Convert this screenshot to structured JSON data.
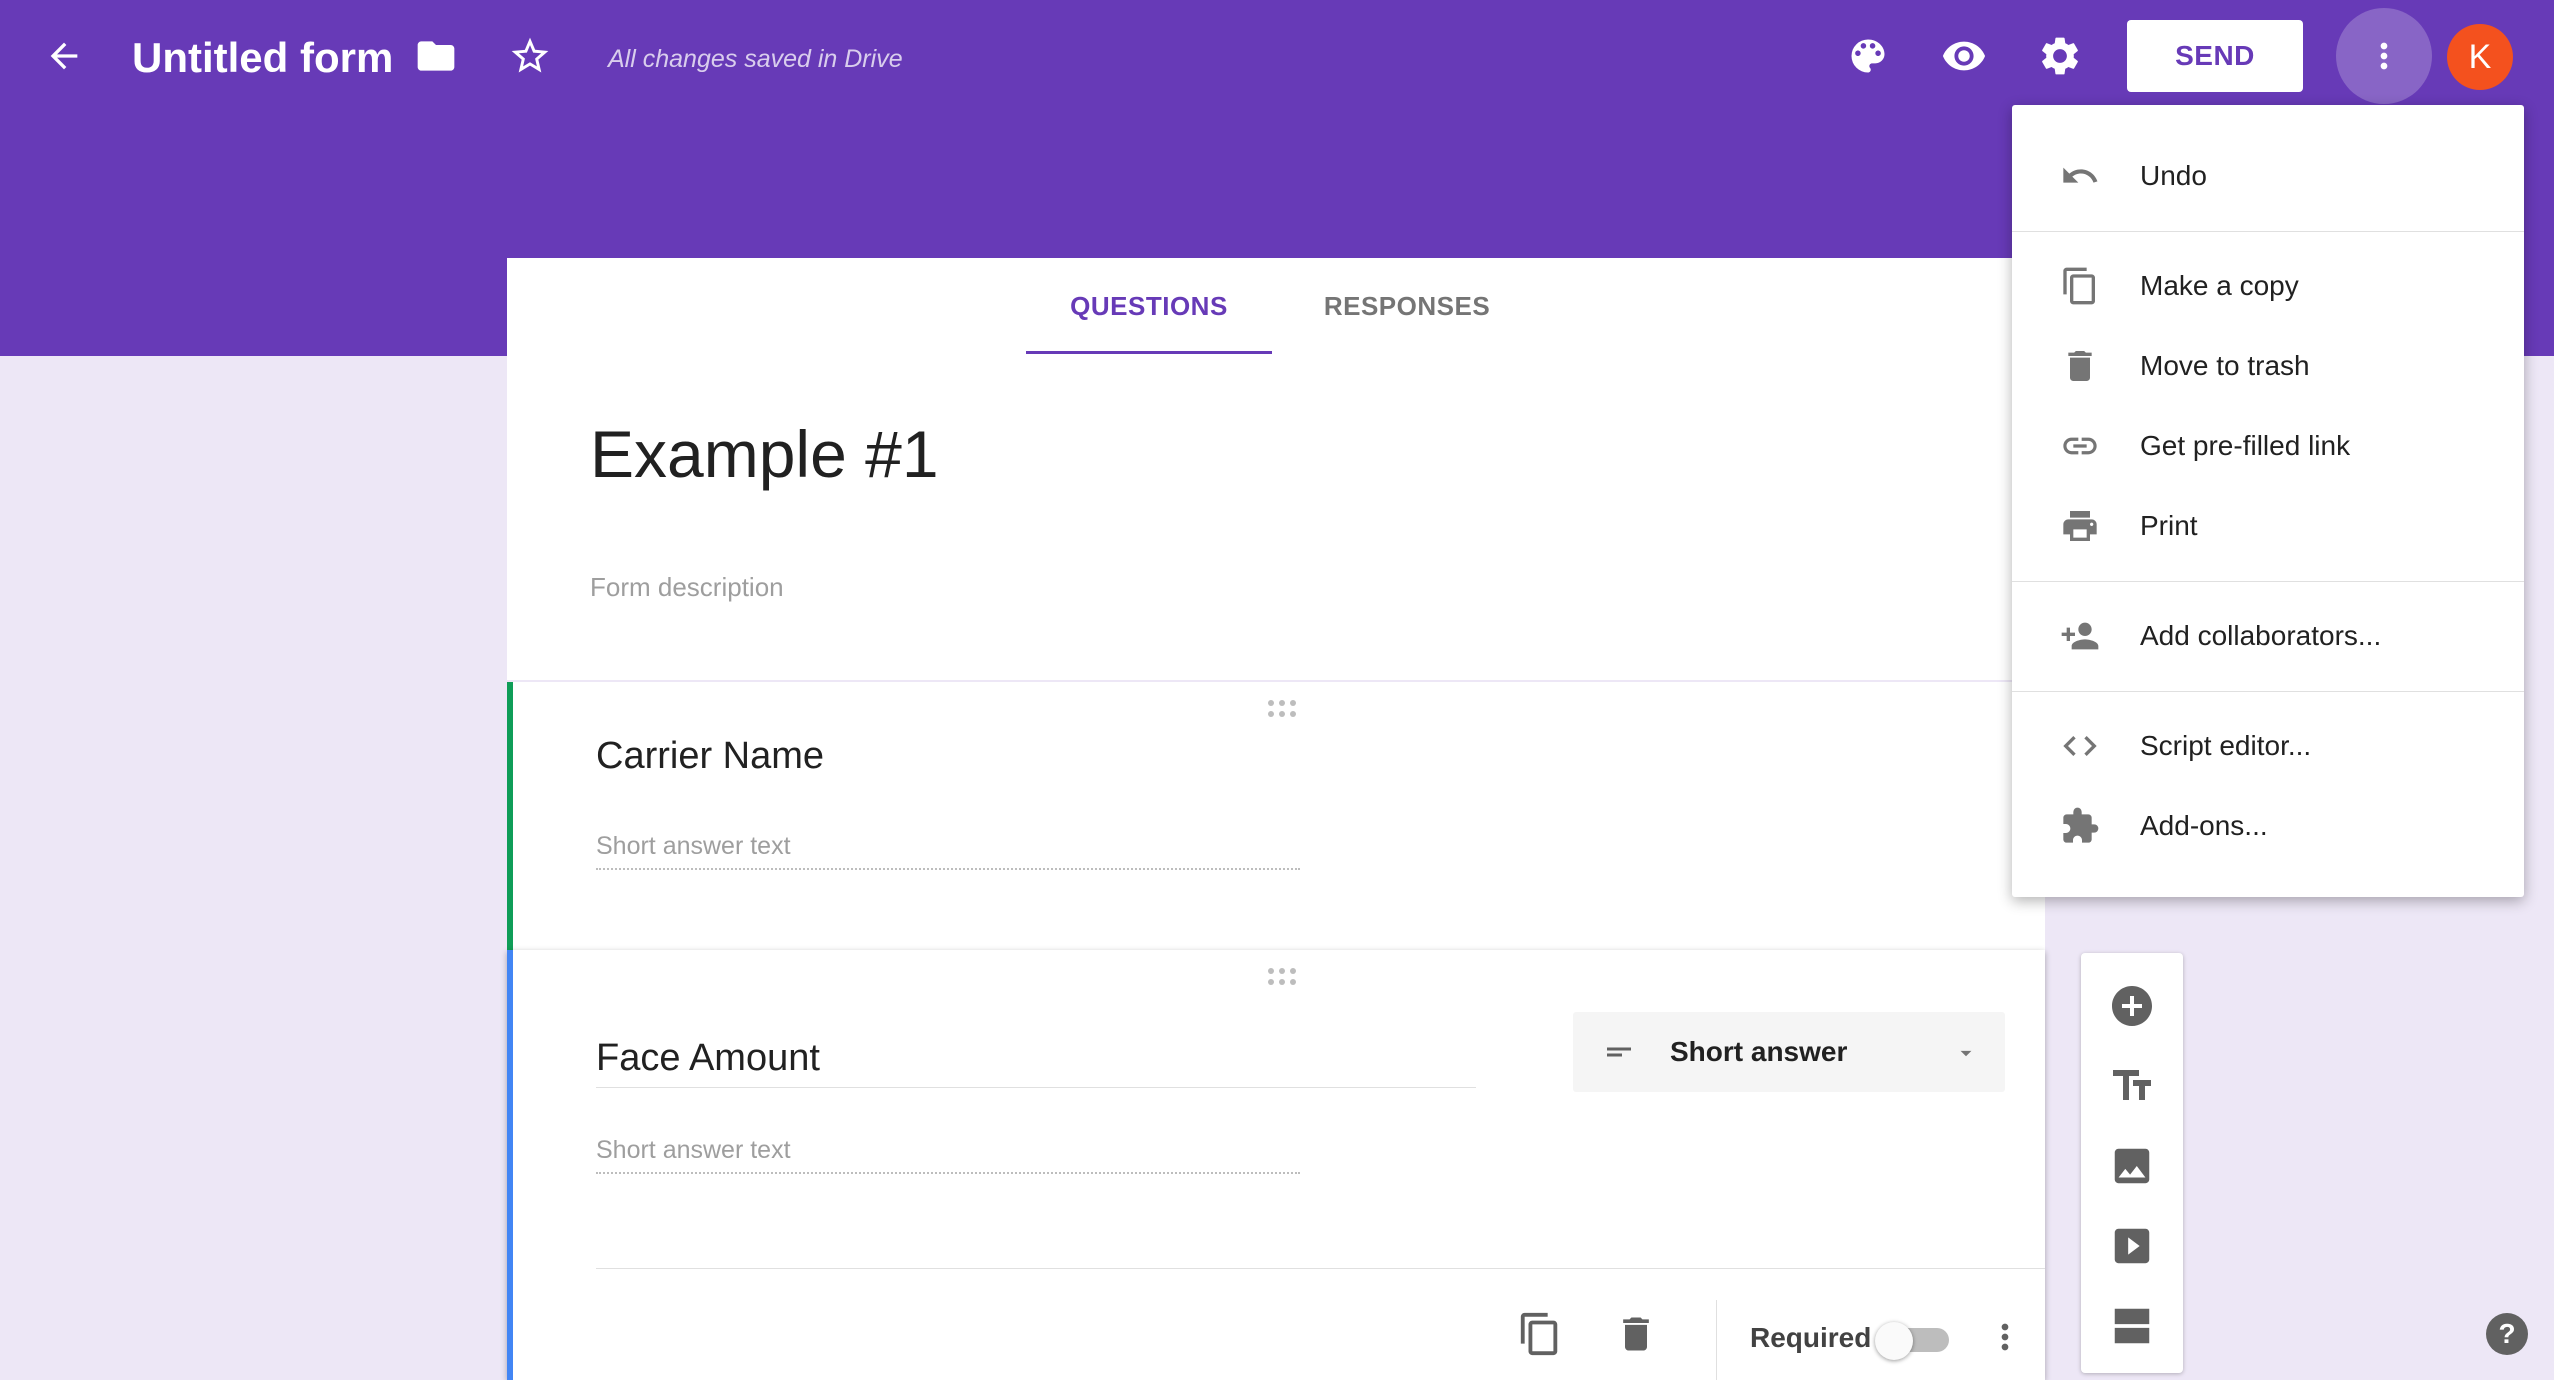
{
  "colors": {
    "accent": "#673ab7",
    "background": "#ede7f6",
    "avatar": "#f4511e",
    "card_green": "#0f9d58",
    "card_blue": "#4285f4"
  },
  "header": {
    "title": "Untitled form",
    "saved_status": "All changes saved in Drive",
    "send_label": "SEND",
    "avatar_initial": "K",
    "icons": [
      "back-arrow-icon",
      "folder-icon",
      "star-icon",
      "palette-icon",
      "eye-icon",
      "gear-icon",
      "more-vert-icon"
    ]
  },
  "tabs": [
    {
      "label": "QUESTIONS",
      "active": true
    },
    {
      "label": "RESPONSES",
      "active": false
    }
  ],
  "form": {
    "title": "Example #1",
    "description_placeholder": "Form description"
  },
  "questions": [
    {
      "title": "Carrier Name",
      "answer_placeholder": "Short answer text"
    },
    {
      "title": "Face Amount",
      "answer_placeholder": "Short answer text",
      "type": "Short answer",
      "required_label": "Required",
      "required": false
    }
  ],
  "menu": {
    "items": [
      {
        "label": "Undo",
        "icon": "undo-icon"
      },
      {
        "label": "Make a copy",
        "icon": "copy-icon"
      },
      {
        "label": "Move to trash",
        "icon": "trash-icon"
      },
      {
        "label": "Get pre-filled link",
        "icon": "link-icon"
      },
      {
        "label": "Print",
        "icon": "print-icon"
      },
      {
        "label": "Add collaborators...",
        "icon": "add-person-icon"
      },
      {
        "label": "Script editor...",
        "icon": "code-icon"
      },
      {
        "label": "Add-ons...",
        "icon": "puzzle-icon"
      }
    ]
  },
  "side_toolbar": [
    "add-question-icon",
    "title-text-icon",
    "image-icon",
    "video-icon",
    "section-icon"
  ],
  "help_label": "?"
}
